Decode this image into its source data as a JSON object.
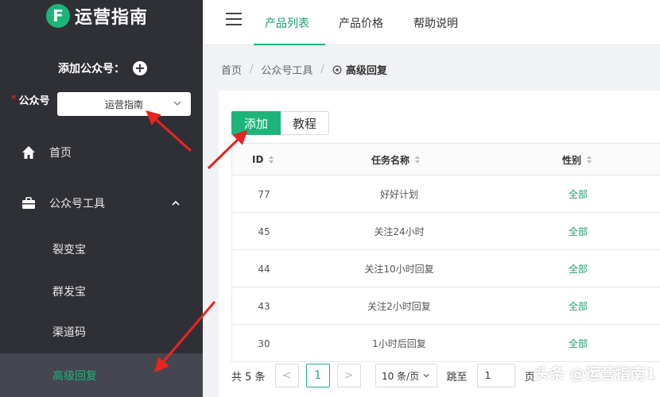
{
  "brand": {
    "logo_letter": "F",
    "name": "运营指南"
  },
  "sidebar": {
    "add_account_label": "添加公众号：",
    "account_field_label": "公众号",
    "account_required_mark": "*",
    "account_selected": "运营指南",
    "nav": [
      {
        "label": "首页",
        "icon": "home-icon"
      },
      {
        "label": "公众号工具",
        "icon": "briefcase-icon",
        "expanded": true
      }
    ],
    "sub_items": [
      {
        "label": "裂变宝"
      },
      {
        "label": "群发宝"
      },
      {
        "label": "渠道码"
      },
      {
        "label": "高级回复",
        "active": true
      }
    ]
  },
  "topbar": {
    "tabs": [
      {
        "label": "产品列表",
        "active": true
      },
      {
        "label": "产品价格"
      },
      {
        "label": "帮助说明"
      }
    ]
  },
  "breadcrumb": {
    "items": [
      "首页",
      "公众号工具"
    ],
    "current": "高级回复"
  },
  "toolbar": {
    "add_label": "添加",
    "tutorial_label": "教程"
  },
  "table": {
    "columns": [
      "ID",
      "任务名称",
      "性别"
    ],
    "rows": [
      {
        "id": "77",
        "name": "好好计划",
        "gender": "全部"
      },
      {
        "id": "45",
        "name": "关注24小时",
        "gender": "全部"
      },
      {
        "id": "44",
        "name": "关注10小时回复",
        "gender": "全部"
      },
      {
        "id": "43",
        "name": "关注2小时回复",
        "gender": "全部"
      },
      {
        "id": "30",
        "name": "1小时后回复",
        "gender": "全部"
      }
    ]
  },
  "pagination": {
    "total_text": "共 5 条",
    "prev": "<",
    "current_page": "1",
    "next": ">",
    "page_size": "10 条/页",
    "jump_label": "跳至",
    "jump_value": "1",
    "page_suffix": "页"
  },
  "watermark": "头条 @运营指南1",
  "colors": {
    "accent": "#1db47a",
    "sidebar_bg": "#2f3036",
    "arrow": "#e8251f"
  }
}
